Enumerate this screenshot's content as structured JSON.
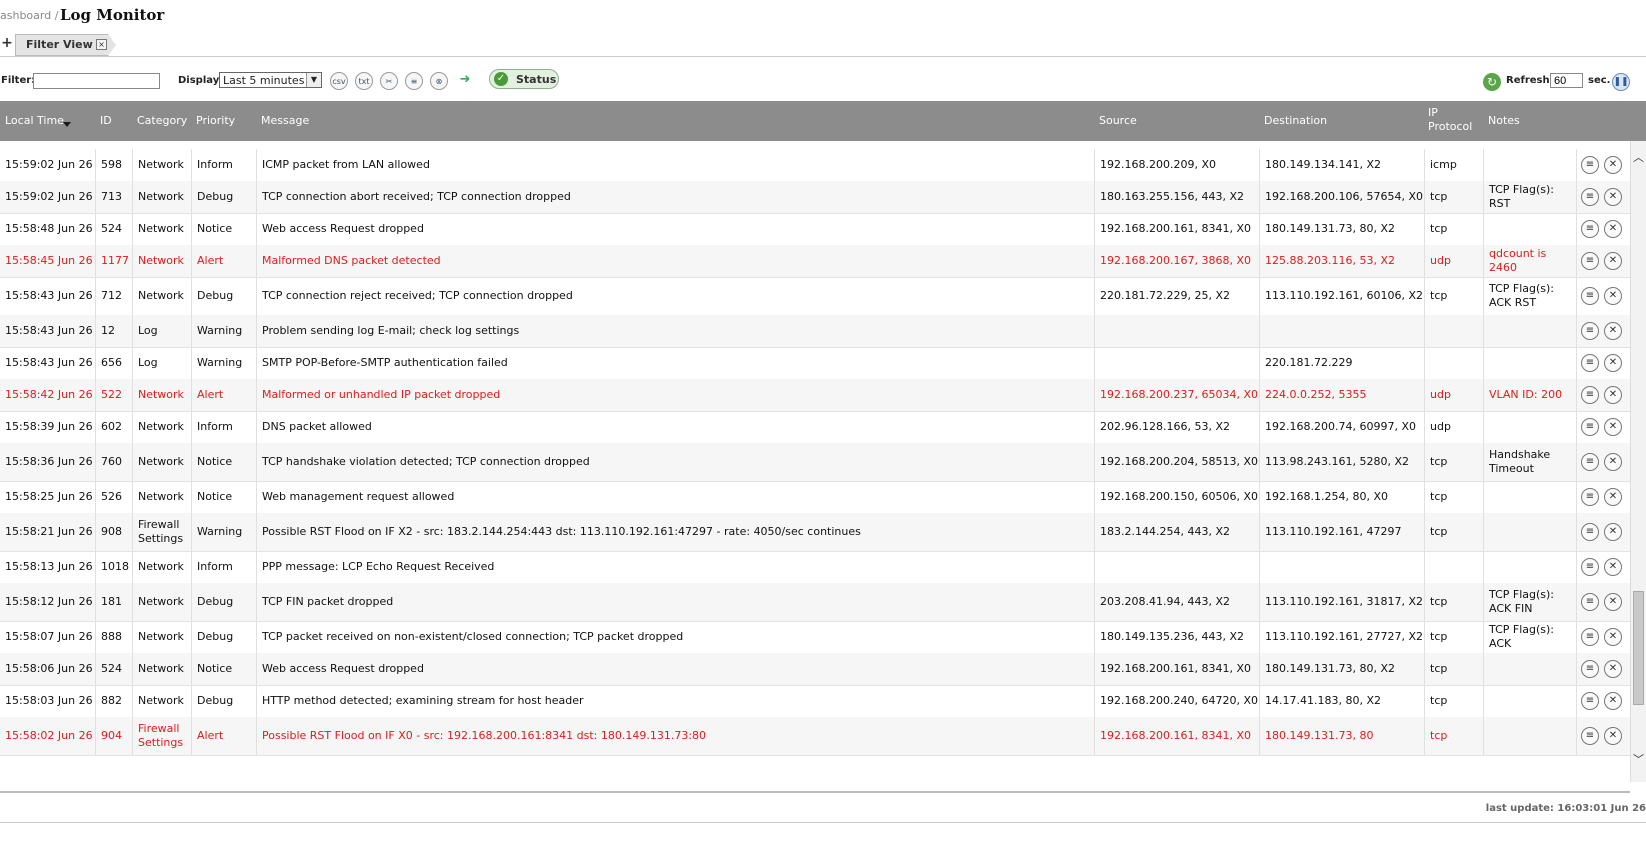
{
  "header": {
    "breadcrumb": "ashboard /",
    "title": "Log Monitor"
  },
  "tabs": {
    "add_label": "+",
    "items": [
      {
        "label": "Filter View",
        "close": "×"
      }
    ]
  },
  "toolbar": {
    "filter_label": "Filter:",
    "filter_value": "",
    "display_label": "Display:",
    "display_value": "Last 5 minutes",
    "export_csv": "csv",
    "export_txt": "txt",
    "status_label": "Status",
    "refresh_label": "Refresh:",
    "refresh_value": "60",
    "refresh_unit": "sec."
  },
  "columns": [
    "Local Time",
    "ID",
    "Category",
    "Priority",
    "Message",
    "Source",
    "Destination",
    "IP Protocol",
    "Notes"
  ],
  "rows": [
    {
      "time": "15:59:02 Jun 26",
      "id": "598",
      "category": "Network",
      "priority": "Inform",
      "message": "ICMP packet from LAN allowed",
      "source": "192.168.200.209, X0",
      "destination": "180.149.134.141, X2",
      "protocol": "icmp",
      "notes": "",
      "alert": false,
      "h": 32
    },
    {
      "time": "15:59:02 Jun 26",
      "id": "713",
      "category": "Network",
      "priority": "Debug",
      "message": "TCP connection abort received; TCP connection dropped",
      "source": "180.163.255.156, 443, X2",
      "destination": "192.168.200.106, 57654, X0",
      "protocol": "tcp",
      "notes": "TCP Flag(s): RST",
      "alert": false,
      "h": 32
    },
    {
      "time": "15:58:48 Jun 26",
      "id": "524",
      "category": "Network",
      "priority": "Notice",
      "message": "Web access Request dropped",
      "source": "192.168.200.161, 8341, X0",
      "destination": "180.149.131.73, 80, X2",
      "protocol": "tcp",
      "notes": "",
      "alert": false,
      "h": 32
    },
    {
      "time": "15:58:45 Jun 26",
      "id": "1177",
      "category": "Network",
      "priority": "Alert",
      "message": "Malformed DNS packet detected",
      "source": "192.168.200.167, 3868, X0",
      "destination": "125.88.203.116, 53, X2",
      "protocol": "udp",
      "notes": "qdcount is 2460",
      "alert": true,
      "h": 32
    },
    {
      "time": "15:58:43 Jun 26",
      "id": "712",
      "category": "Network",
      "priority": "Debug",
      "message": "TCP connection reject received; TCP connection dropped",
      "source": "220.181.72.229, 25, X2",
      "destination": "113.110.192.161, 60106, X2",
      "protocol": "tcp",
      "notes": "TCP Flag(s): ACK RST",
      "alert": false,
      "h": 38
    },
    {
      "time": "15:58:43 Jun 26",
      "id": "12",
      "category": "Log",
      "priority": "Warning",
      "message": "Problem sending log E-mail; check log settings",
      "source": "",
      "destination": "",
      "protocol": "",
      "notes": "",
      "alert": false,
      "h": 32
    },
    {
      "time": "15:58:43 Jun 26",
      "id": "656",
      "category": "Log",
      "priority": "Warning",
      "message": "SMTP POP-Before-SMTP authentication failed",
      "source": "",
      "destination": "220.181.72.229",
      "protocol": "",
      "notes": "",
      "alert": false,
      "h": 32
    },
    {
      "time": "15:58:42 Jun 26",
      "id": "522",
      "category": "Network",
      "priority": "Alert",
      "message": "Malformed or unhandled IP packet dropped",
      "source": "192.168.200.237, 65034, X0",
      "destination": "224.0.0.252, 5355",
      "protocol": "udp",
      "notes": "VLAN ID: 200",
      "alert": true,
      "h": 32
    },
    {
      "time": "15:58:39 Jun 26",
      "id": "602",
      "category": "Network",
      "priority": "Inform",
      "message": "DNS packet allowed",
      "source": "202.96.128.166, 53, X2",
      "destination": "192.168.200.74, 60997, X0",
      "protocol": "udp",
      "notes": "",
      "alert": false,
      "h": 32
    },
    {
      "time": "15:58:36 Jun 26",
      "id": "760",
      "category": "Network",
      "priority": "Notice",
      "message": "TCP handshake violation detected; TCP connection dropped",
      "source": "192.168.200.204, 58513, X0",
      "destination": "113.98.243.161, 5280, X2",
      "protocol": "tcp",
      "notes": "Handshake Timeout",
      "alert": false,
      "h": 38
    },
    {
      "time": "15:58:25 Jun 26",
      "id": "526",
      "category": "Network",
      "priority": "Notice",
      "message": "Web management request allowed",
      "source": "192.168.200.150, 60506, X0",
      "destination": "192.168.1.254, 80, X0",
      "protocol": "tcp",
      "notes": "",
      "alert": false,
      "h": 32
    },
    {
      "time": "15:58:21 Jun 26",
      "id": "908",
      "category": "Firewall Settings",
      "priority": "Warning",
      "message": "Possible RST Flood on IF X2 - src: 183.2.144.254:443 dst: 113.110.192.161:47297 - rate: 4050/sec continues",
      "source": "183.2.144.254, 443, X2",
      "destination": "113.110.192.161, 47297",
      "protocol": "tcp",
      "notes": "",
      "alert": false,
      "h": 38
    },
    {
      "time": "15:58:13 Jun 26",
      "id": "1018",
      "category": "Network",
      "priority": "Inform",
      "message": "PPP message: LCP Echo Request Received",
      "source": "",
      "destination": "",
      "protocol": "",
      "notes": "",
      "alert": false,
      "h": 32
    },
    {
      "time": "15:58:12 Jun 26",
      "id": "181",
      "category": "Network",
      "priority": "Debug",
      "message": "TCP FIN packet dropped",
      "source": "203.208.41.94, 443, X2",
      "destination": "113.110.192.161, 31817, X2",
      "protocol": "tcp",
      "notes": "TCP Flag(s): ACK FIN",
      "alert": false,
      "h": 38
    },
    {
      "time": "15:58:07 Jun 26",
      "id": "888",
      "category": "Network",
      "priority": "Debug",
      "message": "TCP packet received on non-existent/closed connection; TCP packet dropped",
      "source": "180.149.135.236, 443, X2",
      "destination": "113.110.192.161, 27727, X2",
      "protocol": "tcp",
      "notes": "TCP Flag(s): ACK",
      "alert": false,
      "h": 32
    },
    {
      "time": "15:58:06 Jun 26",
      "id": "524",
      "category": "Network",
      "priority": "Notice",
      "message": "Web access Request dropped",
      "source": "192.168.200.161, 8341, X0",
      "destination": "180.149.131.73, 80, X2",
      "protocol": "tcp",
      "notes": "",
      "alert": false,
      "h": 32
    },
    {
      "time": "15:58:03 Jun 26",
      "id": "882",
      "category": "Network",
      "priority": "Debug",
      "message": "HTTP method detected; examining stream for host header",
      "source": "192.168.200.240, 64720, X0",
      "destination": "14.17.41.183, 80, X2",
      "protocol": "tcp",
      "notes": "",
      "alert": false,
      "h": 32
    },
    {
      "time": "15:58:02 Jun 26",
      "id": "904",
      "category": "Firewall Settings",
      "priority": "Alert",
      "message": "Possible RST Flood on IF X0 - src: 192.168.200.161:8341 dst: 180.149.131.73:80",
      "source": "192.168.200.161, 8341, X0",
      "destination": "180.149.131.73, 80",
      "protocol": "tcp",
      "notes": "",
      "alert": true,
      "h": 38
    }
  ],
  "footer": {
    "last_update": "last update: 16:03:01 Jun 26"
  }
}
